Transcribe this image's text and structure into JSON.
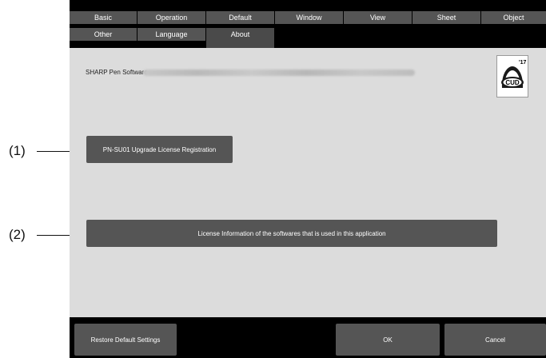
{
  "callouts": {
    "one": "(1)",
    "two": "(2)"
  },
  "tabs": {
    "row1": [
      "Basic",
      "Operation",
      "Default",
      "Window",
      "View",
      "Sheet",
      "Object"
    ],
    "row2": [
      "Other",
      "Language",
      "About"
    ],
    "active": "About"
  },
  "about": {
    "product_name": "SHARP Pen Software",
    "register_button": "PN-SU01 Upgrade License Registration",
    "license_info_button": "License Information of the softwares that is used in this application",
    "cud_logo": {
      "icon": "cud-certification-logo",
      "text": "CUD",
      "year": "'17"
    }
  },
  "footer": {
    "restore_button": "Restore Default Settings",
    "ok_button": "OK",
    "cancel_button": "Cancel"
  },
  "colors": {
    "tab_bg": "#555555",
    "panel_bg": "#000000",
    "content_bg": "#dcdcdc",
    "button_bg": "#555555",
    "button_text": "#ffffff"
  }
}
